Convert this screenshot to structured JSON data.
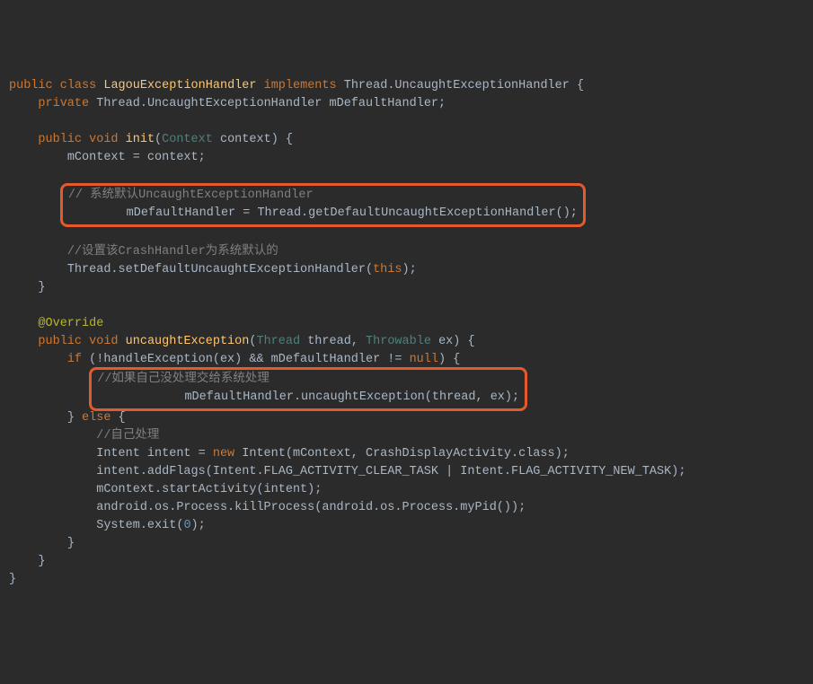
{
  "code": {
    "l1_public": "public",
    "l1_class": "class",
    "l1_name": "LagouExceptionHandler",
    "l1_implements": "implements",
    "l1_iface": "Thread.UncaughtExceptionHandler",
    "l1_brace": "{",
    "l2_private": "private",
    "l2_type": "Thread.UncaughtExceptionHandler",
    "l2_field": "mDefaultHandler;",
    "l4_public": "public",
    "l4_void": "void",
    "l4_method": "init",
    "l4_lp": "(",
    "l4_ptype": "Context",
    "l4_pname": "context",
    "l4_rp": ")",
    "l4_brace": "{",
    "l5_stmt": "mContext = context;",
    "l7_comment": "// 系统默认UncaughtExceptionHandler",
    "l8_stmt": "mDefaultHandler = Thread.getDefaultUncaughtExceptionHandler();",
    "l10_comment": "//设置该CrashHandler为系统默认的",
    "l11_pre": "Thread.setDefaultUncaughtExceptionHandler(",
    "l11_this": "this",
    "l11_post": ");",
    "l12_close": "}",
    "l14_anno": "@Override",
    "l15_public": "public",
    "l15_void": "void",
    "l15_method": "uncaughtException",
    "l15_lp": "(",
    "l15_p1t": "Thread",
    "l15_p1n": "thread",
    "l15_c": ",",
    "l15_p2t": "Throwable",
    "l15_p2n": "ex",
    "l15_rp": ")",
    "l15_brace": "{",
    "l16_if": "if",
    "l16_pre": " (!handleException(ex) && mDefaultHandler != ",
    "l16_null": "null",
    "l16_post": ") {",
    "l17_comment": "//如果自己没处理交给系统处理",
    "l18_stmt": "mDefaultHandler.uncaughtException(thread, ex);",
    "l19_close": "}",
    "l19_else": "else",
    "l19_brace": "{",
    "l20_comment": "//自己处理",
    "l21_pre": "Intent intent = ",
    "l21_new": "new",
    "l21_post": " Intent(mContext, CrashDisplayActivity.class);",
    "l22_stmt": "intent.addFlags(Intent.FLAG_ACTIVITY_CLEAR_TASK | Intent.FLAG_ACTIVITY_NEW_TASK);",
    "l23_stmt": "mContext.startActivity(intent);",
    "l24_stmt": "android.os.Process.killProcess(android.os.Process.myPid());",
    "l25_pre": "System.exit(",
    "l25_num": "0",
    "l25_post": ");",
    "l26_close": "}",
    "l27_close": "}",
    "l28_close": "}"
  }
}
